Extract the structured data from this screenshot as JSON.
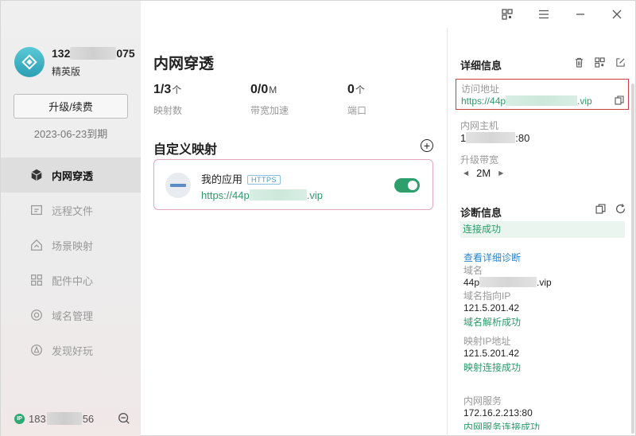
{
  "user": {
    "name_prefix": "132",
    "name_suffix": "075",
    "level": "精英版",
    "upgrade_label": "升级/续费",
    "expire": "2023-06-23到期",
    "ip_prefix": "183",
    "ip_suffix": "56",
    "ip_badge": "IP"
  },
  "nav": [
    {
      "label": "内网穿透",
      "icon": "cube-icon",
      "active": true
    },
    {
      "label": "远程文件",
      "icon": "folder-icon"
    },
    {
      "label": "场景映射",
      "icon": "house-icon"
    },
    {
      "label": "配件中心",
      "icon": "grid-icon"
    },
    {
      "label": "域名管理",
      "icon": "globe-icon"
    },
    {
      "label": "发现好玩",
      "icon": "compass-icon"
    }
  ],
  "main": {
    "title": "内网穿透",
    "stats": [
      {
        "value": "1/3",
        "unit": "个",
        "label": "映射数"
      },
      {
        "value": "0/0",
        "unit": "M",
        "label": "带宽加速"
      },
      {
        "value": "0",
        "unit": "个",
        "label": "端口"
      }
    ],
    "section_title": "自定义映射",
    "add_symbol": "+",
    "mapping": {
      "name": "我的应用",
      "protocol": "HTTPS",
      "url_prefix": "https://44p",
      "url_suffix": ".vip",
      "enabled": true
    }
  },
  "details": {
    "title": "详细信息",
    "visit_label": "访问地址",
    "visit_url_prefix": "https://44p",
    "visit_url_suffix": ".vip",
    "host_label": "内网主机",
    "host_prefix": "1",
    "host_suffix": ":80",
    "bandwidth_label": "升级带宽",
    "bandwidth_value": "2M"
  },
  "diagnosis": {
    "title": "诊断信息",
    "status": "连接成功",
    "detail_link": "查看详细诊断",
    "domain_label": "域名",
    "domain_prefix": "44p",
    "domain_suffix": ".vip",
    "domain_ip_label": "域名指向IP",
    "domain_ip": "121.5.201.42",
    "domain_resolve": "域名解析成功",
    "map_ip_label": "映射IP地址",
    "map_ip": "121.5.201.42",
    "map_connect": "映射连接成功",
    "service_label": "内网服务",
    "service_value": "172.16.2.213:80",
    "service_status": "内网服务连接成功"
  },
  "colors": {
    "accent_green": "#2e9e6c",
    "highlight_red": "#d43b3b",
    "link_blue": "#2a86c8"
  }
}
